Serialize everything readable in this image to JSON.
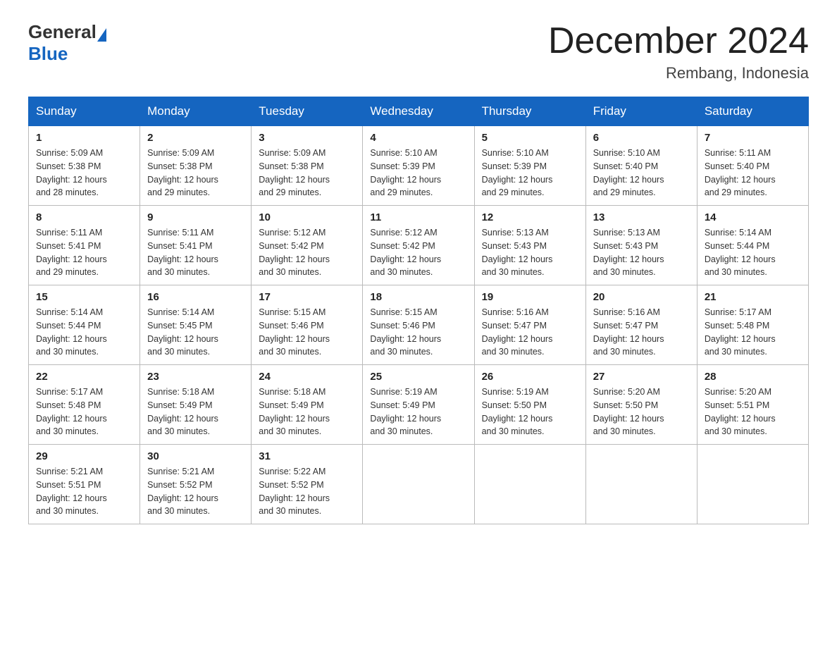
{
  "header": {
    "logo_general": "General",
    "logo_blue": "Blue",
    "title": "December 2024",
    "subtitle": "Rembang, Indonesia"
  },
  "days_of_week": [
    "Sunday",
    "Monday",
    "Tuesday",
    "Wednesday",
    "Thursday",
    "Friday",
    "Saturday"
  ],
  "weeks": [
    [
      {
        "day": "1",
        "sunrise": "5:09 AM",
        "sunset": "5:38 PM",
        "daylight": "12 hours and 28 minutes."
      },
      {
        "day": "2",
        "sunrise": "5:09 AM",
        "sunset": "5:38 PM",
        "daylight": "12 hours and 29 minutes."
      },
      {
        "day": "3",
        "sunrise": "5:09 AM",
        "sunset": "5:38 PM",
        "daylight": "12 hours and 29 minutes."
      },
      {
        "day": "4",
        "sunrise": "5:10 AM",
        "sunset": "5:39 PM",
        "daylight": "12 hours and 29 minutes."
      },
      {
        "day": "5",
        "sunrise": "5:10 AM",
        "sunset": "5:39 PM",
        "daylight": "12 hours and 29 minutes."
      },
      {
        "day": "6",
        "sunrise": "5:10 AM",
        "sunset": "5:40 PM",
        "daylight": "12 hours and 29 minutes."
      },
      {
        "day": "7",
        "sunrise": "5:11 AM",
        "sunset": "5:40 PM",
        "daylight": "12 hours and 29 minutes."
      }
    ],
    [
      {
        "day": "8",
        "sunrise": "5:11 AM",
        "sunset": "5:41 PM",
        "daylight": "12 hours and 29 minutes."
      },
      {
        "day": "9",
        "sunrise": "5:11 AM",
        "sunset": "5:41 PM",
        "daylight": "12 hours and 30 minutes."
      },
      {
        "day": "10",
        "sunrise": "5:12 AM",
        "sunset": "5:42 PM",
        "daylight": "12 hours and 30 minutes."
      },
      {
        "day": "11",
        "sunrise": "5:12 AM",
        "sunset": "5:42 PM",
        "daylight": "12 hours and 30 minutes."
      },
      {
        "day": "12",
        "sunrise": "5:13 AM",
        "sunset": "5:43 PM",
        "daylight": "12 hours and 30 minutes."
      },
      {
        "day": "13",
        "sunrise": "5:13 AM",
        "sunset": "5:43 PM",
        "daylight": "12 hours and 30 minutes."
      },
      {
        "day": "14",
        "sunrise": "5:14 AM",
        "sunset": "5:44 PM",
        "daylight": "12 hours and 30 minutes."
      }
    ],
    [
      {
        "day": "15",
        "sunrise": "5:14 AM",
        "sunset": "5:44 PM",
        "daylight": "12 hours and 30 minutes."
      },
      {
        "day": "16",
        "sunrise": "5:14 AM",
        "sunset": "5:45 PM",
        "daylight": "12 hours and 30 minutes."
      },
      {
        "day": "17",
        "sunrise": "5:15 AM",
        "sunset": "5:46 PM",
        "daylight": "12 hours and 30 minutes."
      },
      {
        "day": "18",
        "sunrise": "5:15 AM",
        "sunset": "5:46 PM",
        "daylight": "12 hours and 30 minutes."
      },
      {
        "day": "19",
        "sunrise": "5:16 AM",
        "sunset": "5:47 PM",
        "daylight": "12 hours and 30 minutes."
      },
      {
        "day": "20",
        "sunrise": "5:16 AM",
        "sunset": "5:47 PM",
        "daylight": "12 hours and 30 minutes."
      },
      {
        "day": "21",
        "sunrise": "5:17 AM",
        "sunset": "5:48 PM",
        "daylight": "12 hours and 30 minutes."
      }
    ],
    [
      {
        "day": "22",
        "sunrise": "5:17 AM",
        "sunset": "5:48 PM",
        "daylight": "12 hours and 30 minutes."
      },
      {
        "day": "23",
        "sunrise": "5:18 AM",
        "sunset": "5:49 PM",
        "daylight": "12 hours and 30 minutes."
      },
      {
        "day": "24",
        "sunrise": "5:18 AM",
        "sunset": "5:49 PM",
        "daylight": "12 hours and 30 minutes."
      },
      {
        "day": "25",
        "sunrise": "5:19 AM",
        "sunset": "5:49 PM",
        "daylight": "12 hours and 30 minutes."
      },
      {
        "day": "26",
        "sunrise": "5:19 AM",
        "sunset": "5:50 PM",
        "daylight": "12 hours and 30 minutes."
      },
      {
        "day": "27",
        "sunrise": "5:20 AM",
        "sunset": "5:50 PM",
        "daylight": "12 hours and 30 minutes."
      },
      {
        "day": "28",
        "sunrise": "5:20 AM",
        "sunset": "5:51 PM",
        "daylight": "12 hours and 30 minutes."
      }
    ],
    [
      {
        "day": "29",
        "sunrise": "5:21 AM",
        "sunset": "5:51 PM",
        "daylight": "12 hours and 30 minutes."
      },
      {
        "day": "30",
        "sunrise": "5:21 AM",
        "sunset": "5:52 PM",
        "daylight": "12 hours and 30 minutes."
      },
      {
        "day": "31",
        "sunrise": "5:22 AM",
        "sunset": "5:52 PM",
        "daylight": "12 hours and 30 minutes."
      },
      null,
      null,
      null,
      null
    ]
  ],
  "labels": {
    "sunrise": "Sunrise:",
    "sunset": "Sunset:",
    "daylight": "Daylight:"
  }
}
